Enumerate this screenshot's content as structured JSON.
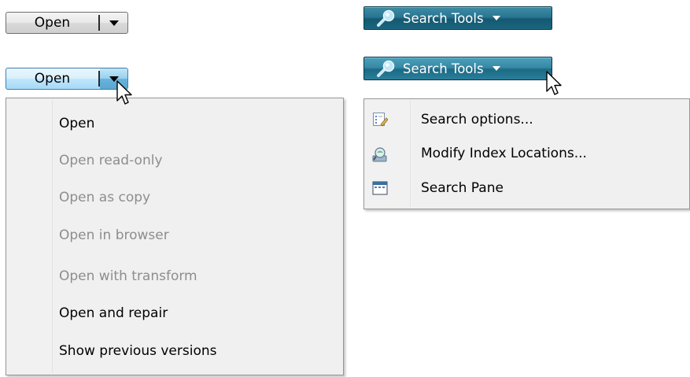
{
  "open_button": {
    "label": "Open"
  },
  "open_button_hot": {
    "label": "Open"
  },
  "open_menu": {
    "items": [
      {
        "label": "Open",
        "enabled": true
      },
      {
        "label": "Open read-only",
        "enabled": false
      },
      {
        "label": "Open as copy",
        "enabled": false
      },
      {
        "label": "Open in browser",
        "enabled": false
      },
      {
        "label": "Open with transform",
        "enabled": false
      },
      {
        "label": "Open and repair",
        "enabled": true
      },
      {
        "label": "Show previous versions",
        "enabled": true
      }
    ]
  },
  "search_button": {
    "label": "Search Tools",
    "icon": "search-icon"
  },
  "search_button_hot": {
    "label": "Search Tools",
    "icon": "search-icon"
  },
  "search_menu": {
    "items": [
      {
        "label": "Search options...",
        "icon": "options-icon"
      },
      {
        "label": "Modify Index Locations...",
        "icon": "index-locations-icon"
      },
      {
        "label": "Search Pane",
        "icon": "search-pane-icon"
      }
    ]
  },
  "colors": {
    "search_button": "#1b6680",
    "open_button_hot": "#bee6fd",
    "disabled_text": "#8d8d8d"
  }
}
